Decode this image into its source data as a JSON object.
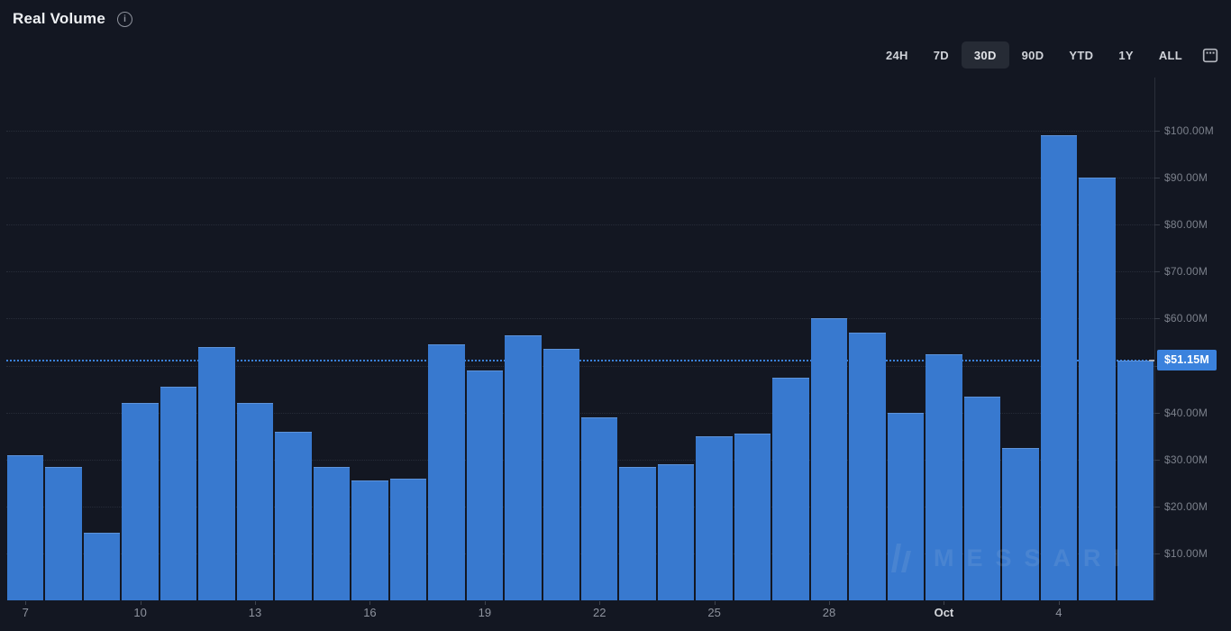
{
  "header": {
    "title": "Real Volume",
    "info_icon": "info-icon"
  },
  "toolbar": {
    "ranges": [
      {
        "label": "24H",
        "selected": false
      },
      {
        "label": "7D",
        "selected": false
      },
      {
        "label": "30D",
        "selected": true
      },
      {
        "label": "90D",
        "selected": false
      },
      {
        "label": "YTD",
        "selected": false
      },
      {
        "label": "1Y",
        "selected": false
      },
      {
        "label": "ALL",
        "selected": false
      }
    ],
    "calendar_icon": "calendar-icon"
  },
  "chart_data": {
    "type": "bar",
    "title": "Real Volume",
    "unit": "USD, daily real volume in millions",
    "x": [
      "7",
      "8",
      "9",
      "10",
      "11",
      "12",
      "13",
      "14",
      "15",
      "16",
      "17",
      "18",
      "19",
      "20",
      "21",
      "22",
      "23",
      "24",
      "25",
      "26",
      "27",
      "28",
      "29",
      "30",
      "Oct 1",
      "Oct 2",
      "Oct 3",
      "Oct 4",
      "Oct 5",
      "Oct 6"
    ],
    "values": [
      31,
      28.5,
      14.5,
      42,
      45.5,
      54,
      42,
      36,
      28.5,
      25.5,
      26,
      54.5,
      49,
      56.5,
      53.5,
      39,
      28.5,
      29,
      35,
      35.5,
      47.5,
      60,
      57,
      40,
      52.5,
      43.5,
      32.5,
      98.9,
      89.9,
      51.15
    ],
    "x_ticks": [
      {
        "label": "7",
        "index": 0,
        "emphasized": false
      },
      {
        "label": "10",
        "index": 3,
        "emphasized": false
      },
      {
        "label": "13",
        "index": 6,
        "emphasized": false
      },
      {
        "label": "16",
        "index": 9,
        "emphasized": false
      },
      {
        "label": "19",
        "index": 12,
        "emphasized": false
      },
      {
        "label": "22",
        "index": 15,
        "emphasized": false
      },
      {
        "label": "25",
        "index": 18,
        "emphasized": false
      },
      {
        "label": "28",
        "index": 21,
        "emphasized": false
      },
      {
        "label": "Oct",
        "index": 24,
        "emphasized": true
      },
      {
        "label": "4",
        "index": 27,
        "emphasized": false
      }
    ],
    "y_axis": {
      "range": [
        0,
        110
      ],
      "grid": true,
      "ticks": [
        {
          "value": 100,
          "label": "$100.00M"
        },
        {
          "value": 90,
          "label": "$90.00M"
        },
        {
          "value": 80,
          "label": "$80.00M"
        },
        {
          "value": 70,
          "label": "$70.00M"
        },
        {
          "value": 60,
          "label": "$60.00M"
        },
        {
          "value": 50,
          "label": ""
        },
        {
          "value": 40,
          "label": "$40.00M"
        },
        {
          "value": 30,
          "label": "$30.00M"
        },
        {
          "value": 20,
          "label": "$20.00M"
        },
        {
          "value": 10,
          "label": "$10.00M"
        }
      ]
    },
    "current": {
      "label": "$51.15M",
      "value": 51.15
    },
    "colors": {
      "background": "#131722",
      "bar": "#3879cf",
      "bar_top_edge": "#5d93da",
      "current_line": "#3b82dd",
      "gridline": "#272c38",
      "axis_text": "#7b808b"
    },
    "watermark": "MESSARI"
  }
}
